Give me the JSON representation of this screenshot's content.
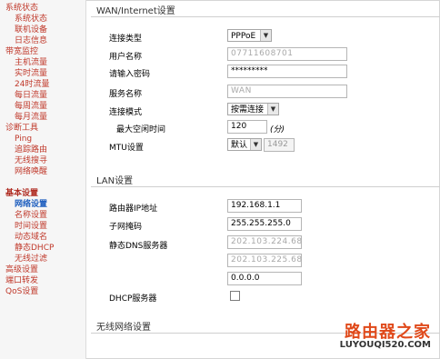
{
  "sidebar": {
    "items": [
      {
        "label": "系统状态",
        "level": 1
      },
      {
        "label": "系统状态",
        "level": 2
      },
      {
        "label": "联机设备",
        "level": 2
      },
      {
        "label": "日志信息",
        "level": 2
      },
      {
        "label": "带宽监控",
        "level": 1
      },
      {
        "label": "主机流量",
        "level": 2
      },
      {
        "label": "实时流量",
        "level": 2
      },
      {
        "label": "24时流量",
        "level": 2
      },
      {
        "label": "每日流量",
        "level": 2
      },
      {
        "label": "每周流量",
        "level": 2
      },
      {
        "label": "每月流量",
        "level": 2
      },
      {
        "label": "诊断工具",
        "level": 1
      },
      {
        "label": "Ping",
        "level": 2
      },
      {
        "label": "追踪路由",
        "level": 2
      },
      {
        "label": "无线搜寻",
        "level": 2
      },
      {
        "label": "网络唤醒",
        "level": 2
      },
      {
        "label": "基本设置",
        "level": 1,
        "bold": true
      },
      {
        "label": "网络设置",
        "level": 2,
        "active": true
      },
      {
        "label": "名称设置",
        "level": 2
      },
      {
        "label": "时间设置",
        "level": 2
      },
      {
        "label": "动态域名",
        "level": 2
      },
      {
        "label": "静态DHCP",
        "level": 2
      },
      {
        "label": "无线过滤",
        "level": 2
      },
      {
        "label": "高级设置",
        "level": 1
      },
      {
        "label": "端口转发",
        "level": 1
      },
      {
        "label": "QoS设置",
        "level": 1
      }
    ]
  },
  "wan": {
    "title": "WAN/Internet设置",
    "connection_type_label": "连接类型",
    "connection_type_value": "PPPoE",
    "username_label": "用户名称",
    "username_value": "07711608701",
    "password_label": "请输入密码",
    "password_value": "*********",
    "service_name_label": "服务名称",
    "service_name_value": "WAN",
    "connect_mode_label": "连接模式",
    "connect_mode_value": "按需连接",
    "max_idle_label": "最大空闲时间",
    "max_idle_value": "120",
    "max_idle_unit": "(分)",
    "mtu_label": "MTU设置",
    "mtu_mode": "默认",
    "mtu_value": "1492"
  },
  "lan": {
    "title": "LAN设置",
    "router_ip_label": "路由器IP地址",
    "router_ip_value": "192.168.1.1",
    "subnet_label": "子网掩码",
    "subnet_value": "255.255.255.0",
    "dns_label": "静态DNS服务器",
    "dns1_value": "202.103.224.68",
    "dns2_value": "202.103.225.68",
    "dns3_value": "0.0.0.0",
    "dhcp_label": "DHCP服务器",
    "dhcp_enabled": false
  },
  "wireless": {
    "title": "无线网络设置"
  },
  "watermark": {
    "main": "路由器之家",
    "url": "LUYOUQI520.COM"
  }
}
